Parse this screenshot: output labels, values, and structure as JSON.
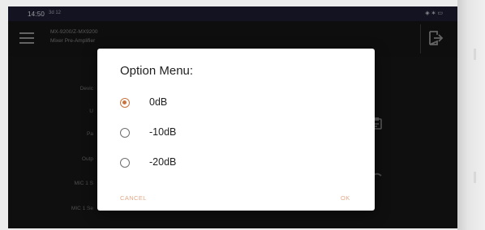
{
  "status_bar": {
    "time": "14:50",
    "extra": "3d 12",
    "right": "◈ ∗ ▭"
  },
  "app_bar": {
    "title_line1": "MX-9200/Z-MX9200",
    "title_line2": "Mixer Pre-Amplifier"
  },
  "background": {
    "labels": [
      "Devic",
      "U",
      "Pa",
      "Outp",
      "MIC 1 S",
      "MIC 1 Se"
    ]
  },
  "dialog": {
    "title": "Option Menu:",
    "options": [
      {
        "label": "0dB",
        "selected": true
      },
      {
        "label": "-10dB",
        "selected": false
      },
      {
        "label": "-20dB",
        "selected": false
      }
    ],
    "cancel_label": "CANCEL",
    "ok_label": "OK"
  },
  "colors": {
    "accent": "#c9753f",
    "button_text": "#e2a98a"
  },
  "icons": {
    "menu": "hamburger-menu-icon",
    "exit": "exit-icon",
    "clipboard": "clipboard-icon",
    "undo": "undo-icon"
  }
}
